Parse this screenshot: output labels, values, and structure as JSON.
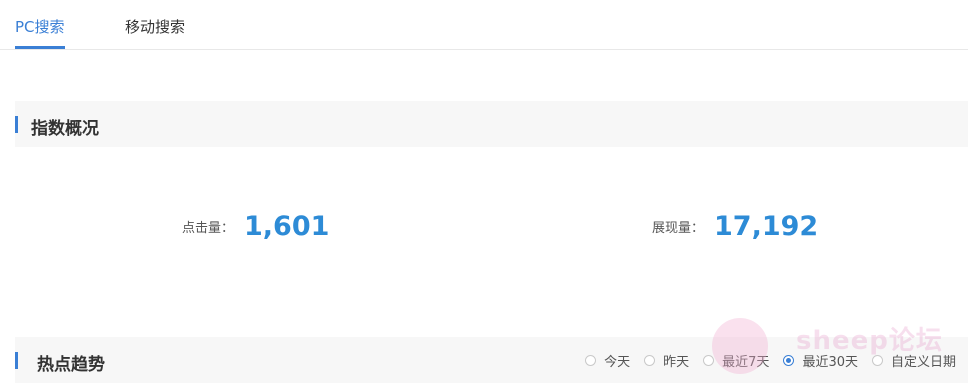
{
  "tabs": [
    {
      "label": "PC搜索",
      "active": true
    },
    {
      "label": "移动搜索",
      "active": false
    }
  ],
  "overview": {
    "title": "指数概况",
    "clicks": {
      "label": "点击量：",
      "value": "1,601"
    },
    "impressions": {
      "label": "展现量：",
      "value": "17,192"
    }
  },
  "trend": {
    "title": "热点趋势",
    "range_options": [
      {
        "label": "今天",
        "selected": false
      },
      {
        "label": "昨天",
        "selected": false
      },
      {
        "label": "最近7天",
        "selected": false
      },
      {
        "label": "最近30天",
        "selected": true
      },
      {
        "label": "自定义日期",
        "selected": false
      }
    ]
  },
  "watermark": {
    "text": "sheep论坛"
  },
  "colors": {
    "accent": "#3a7fd5",
    "value": "#2d8bd6",
    "section_bg": "#f7f7f7"
  }
}
